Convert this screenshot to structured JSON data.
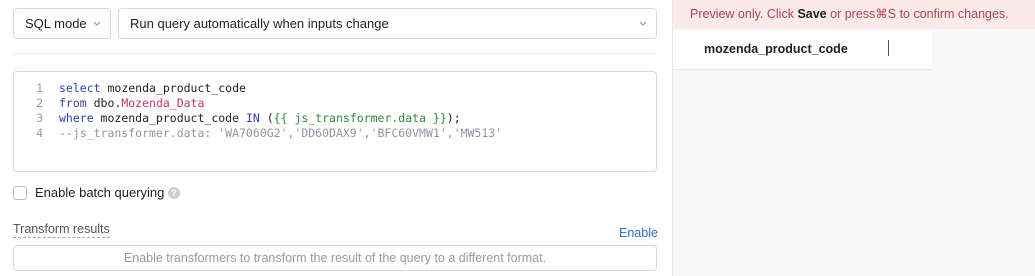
{
  "query_settings": {
    "mode_select": "SQL mode",
    "run_select": "Run query automatically when inputs change"
  },
  "editor": {
    "lines": [
      {
        "num": "1",
        "tokens": [
          {
            "t": "select",
            "c": "kw"
          },
          {
            "t": " mozenda_product_code",
            "c": ""
          }
        ]
      },
      {
        "num": "2",
        "tokens": [
          {
            "t": "from",
            "c": "kw"
          },
          {
            "t": " dbo.",
            "c": ""
          },
          {
            "t": "Mozenda_Data",
            "c": "tbl"
          }
        ]
      },
      {
        "num": "3",
        "tokens": [
          {
            "t": "where",
            "c": "kw"
          },
          {
            "t": " mozenda_product_code ",
            "c": ""
          },
          {
            "t": "IN",
            "c": "kw"
          },
          {
            "t": " (",
            "c": ""
          },
          {
            "t": "{{ js_transformer.data }}",
            "c": "tmpl"
          },
          {
            "t": ");",
            "c": ""
          }
        ]
      },
      {
        "num": "4",
        "tokens": [
          {
            "t": "--js_transformer.data: 'WA7060G2','DD60DAX9','BFC60VMW1','MW513'",
            "c": "cmt"
          }
        ]
      }
    ]
  },
  "batch": {
    "label": "Enable batch querying",
    "checked": false,
    "help_icon": "question-circle-icon"
  },
  "transform": {
    "label": "Transform results",
    "enable_link": "Enable",
    "placeholder": "Enable transformers to transform the result of the query to a different format."
  },
  "preview": {
    "banner_prefix": "Preview only.  Click ",
    "banner_save": "Save",
    "banner_suffix": " or press⌘S to confirm changes.",
    "column_header": "mozenda_product_code"
  },
  "colors": {
    "keyword": "#2d3fb5",
    "table": "#c4336b",
    "template": "#2b8a3e",
    "comment": "#8e96a3",
    "link": "#2f6fd0",
    "banner_bg": "#fbeaea",
    "banner_text": "#b0454f"
  }
}
